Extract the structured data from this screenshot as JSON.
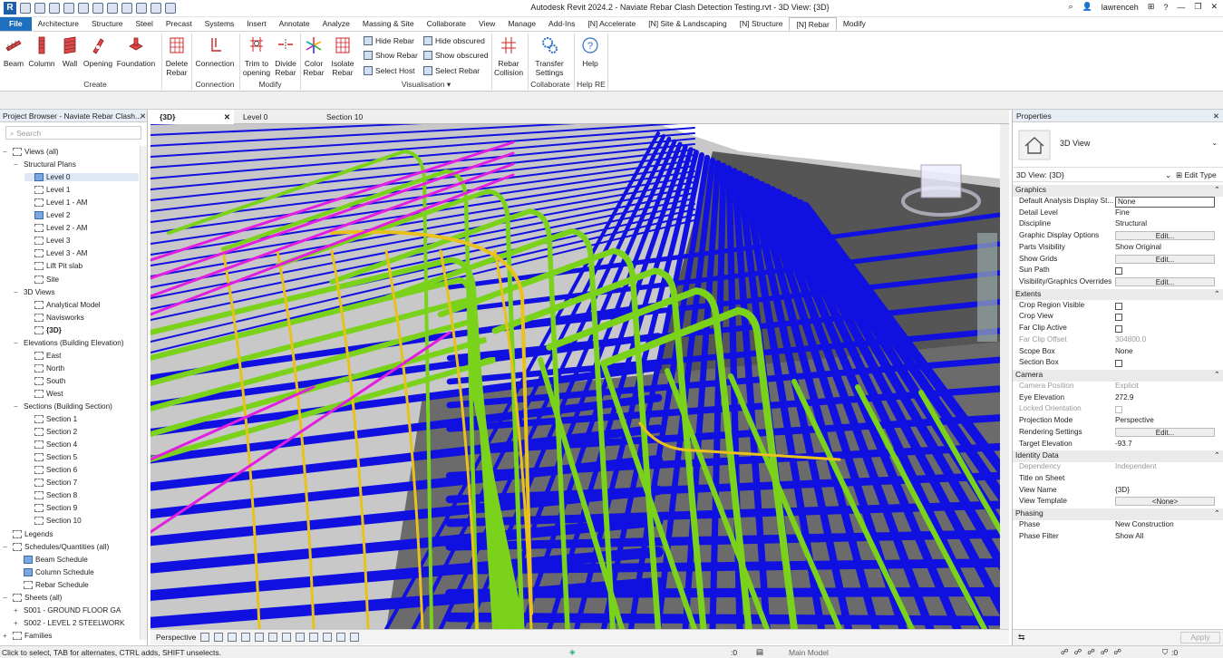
{
  "titlebar": {
    "title": "Autodesk Revit 2024.2 - Naviate Rebar Clash Detection Testing.rvt - 3D View: {3D}",
    "user": "lawrenceh"
  },
  "menu_tabs": [
    "File",
    "Architecture",
    "Structure",
    "Steel",
    "Precast",
    "Systems",
    "Insert",
    "Annotate",
    "Analyze",
    "Massing & Site",
    "Collaborate",
    "View",
    "Manage",
    "Add-Ins",
    "[N] Accelerate",
    "[N] Site & Landscaping",
    "[N] Structure",
    "[N] Rebar",
    "Modify"
  ],
  "ribbon": {
    "create": [
      "Beam",
      "Column",
      "Wall",
      "Opening",
      "Foundation"
    ],
    "delete_rebar": [
      "Delete",
      "Rebar"
    ],
    "connection": "Connection",
    "trim": [
      "Trim to",
      "opening"
    ],
    "divide": [
      "Divide",
      "Rebar"
    ],
    "color": [
      "Color",
      "Rebar"
    ],
    "isolate": [
      "Isolate",
      "Rebar"
    ],
    "visual_small": [
      "Hide Rebar",
      "Show Rebar",
      "Select Host",
      "Hide obscured",
      "Show obscured",
      "Select Rebar"
    ],
    "collision": [
      "Rebar",
      "Collision"
    ],
    "transfer": [
      "Transfer",
      "Settings"
    ],
    "help": "Help",
    "groups": [
      "Create",
      "Connection",
      "Modify",
      "Visualisation",
      "Collaborate",
      "Help RE"
    ]
  },
  "project_browser": {
    "title": "Project Browser - Naviate Rebar Clash...",
    "search_placeholder": "Search",
    "nodes": [
      {
        "label": "Views (all)",
        "level": 0,
        "toggle": "−",
        "icon": "views"
      },
      {
        "label": "Structural Plans",
        "level": 1,
        "toggle": "−",
        "icon": ""
      },
      {
        "label": "Level 0",
        "level": 2,
        "toggle": "",
        "icon": "blue",
        "selected": true
      },
      {
        "label": "Level 1",
        "level": 2,
        "toggle": "",
        "icon": "view"
      },
      {
        "label": "Level 1 - AM",
        "level": 2,
        "toggle": "",
        "icon": "view"
      },
      {
        "label": "Level 2",
        "level": 2,
        "toggle": "",
        "icon": "blue"
      },
      {
        "label": "Level 2 - AM",
        "level": 2,
        "toggle": "",
        "icon": "view"
      },
      {
        "label": "Level 3",
        "level": 2,
        "toggle": "",
        "icon": "view"
      },
      {
        "label": "Level 3 - AM",
        "level": 2,
        "toggle": "",
        "icon": "view"
      },
      {
        "label": "Lift Pit slab",
        "level": 2,
        "toggle": "",
        "icon": "view"
      },
      {
        "label": "Site",
        "level": 2,
        "toggle": "",
        "icon": "view"
      },
      {
        "label": "3D Views",
        "level": 1,
        "toggle": "−",
        "icon": ""
      },
      {
        "label": "Analytical Model",
        "level": 2,
        "toggle": "",
        "icon": "view"
      },
      {
        "label": "Navisworks",
        "level": 2,
        "toggle": "",
        "icon": "view"
      },
      {
        "label": "{3D}",
        "level": 2,
        "toggle": "",
        "icon": "view",
        "bold": true
      },
      {
        "label": "Elevations (Building Elevation)",
        "level": 1,
        "toggle": "−",
        "icon": ""
      },
      {
        "label": "East",
        "level": 2,
        "toggle": "",
        "icon": "view"
      },
      {
        "label": "North",
        "level": 2,
        "toggle": "",
        "icon": "view"
      },
      {
        "label": "South",
        "level": 2,
        "toggle": "",
        "icon": "view"
      },
      {
        "label": "West",
        "level": 2,
        "toggle": "",
        "icon": "view"
      },
      {
        "label": "Sections (Building Section)",
        "level": 1,
        "toggle": "−",
        "icon": ""
      },
      {
        "label": "Section 1",
        "level": 2,
        "toggle": "",
        "icon": "view"
      },
      {
        "label": "Section 2",
        "level": 2,
        "toggle": "",
        "icon": "view"
      },
      {
        "label": "Section 4",
        "level": 2,
        "toggle": "",
        "icon": "view"
      },
      {
        "label": "Section 5",
        "level": 2,
        "toggle": "",
        "icon": "view"
      },
      {
        "label": "Section 6",
        "level": 2,
        "toggle": "",
        "icon": "view"
      },
      {
        "label": "Section 7",
        "level": 2,
        "toggle": "",
        "icon": "view"
      },
      {
        "label": "Section 8",
        "level": 2,
        "toggle": "",
        "icon": "view"
      },
      {
        "label": "Section 9",
        "level": 2,
        "toggle": "",
        "icon": "view"
      },
      {
        "label": "Section 10",
        "level": 2,
        "toggle": "",
        "icon": "view"
      },
      {
        "label": "Legends",
        "level": 0,
        "toggle": "",
        "icon": "view"
      },
      {
        "label": "Schedules/Quantities (all)",
        "level": 0,
        "toggle": "−",
        "icon": "view"
      },
      {
        "label": "Beam Schedule",
        "level": 1,
        "toggle": "",
        "icon": "blue"
      },
      {
        "label": "Column Schedule",
        "level": 1,
        "toggle": "",
        "icon": "blue"
      },
      {
        "label": "Rebar Schedule",
        "level": 1,
        "toggle": "",
        "icon": "view"
      },
      {
        "label": "Sheets (all)",
        "level": 0,
        "toggle": "−",
        "icon": "view"
      },
      {
        "label": "S001 - GROUND FLOOR GA",
        "level": 1,
        "toggle": "+",
        "icon": ""
      },
      {
        "label": "S002 - LEVEL 2 STEELWORK",
        "level": 1,
        "toggle": "+",
        "icon": ""
      },
      {
        "label": "Families",
        "level": 0,
        "toggle": "+",
        "icon": "view"
      }
    ]
  },
  "view_tabs": [
    {
      "label": "{3D}",
      "active": true
    },
    {
      "label": "Level 0",
      "active": false
    },
    {
      "label": "Section 10",
      "active": false
    }
  ],
  "view_bar": {
    "scale": "Perspective"
  },
  "properties": {
    "title": "Properties",
    "type_name": "3D View",
    "instance": "3D View: {3D}",
    "edit_type": "Edit Type",
    "rows": [
      {
        "kind": "header",
        "name": "Graphics"
      },
      {
        "name": "Default Analysis Display St...",
        "value": "None",
        "type": "input"
      },
      {
        "name": "Detail Level",
        "value": "Fine"
      },
      {
        "name": "Discipline",
        "value": "Structural"
      },
      {
        "name": "Graphic Display Options",
        "value": "Edit...",
        "type": "button"
      },
      {
        "name": "Parts Visibility",
        "value": "Show Original"
      },
      {
        "name": "Show Grids",
        "value": "Edit...",
        "type": "button"
      },
      {
        "name": "Sun Path",
        "value": "",
        "type": "check"
      },
      {
        "name": "Visibility/Graphics Overrides",
        "value": "Edit...",
        "type": "button"
      },
      {
        "kind": "header",
        "name": "Extents"
      },
      {
        "name": "Crop Region Visible",
        "value": "",
        "type": "check"
      },
      {
        "name": "Crop View",
        "value": "",
        "type": "check"
      },
      {
        "name": "Far Clip Active",
        "value": "",
        "type": "check"
      },
      {
        "name": "Far Clip Offset",
        "value": "304800.0",
        "dim": true
      },
      {
        "name": "Scope Box",
        "value": "None"
      },
      {
        "name": "Section Box",
        "value": "",
        "type": "check"
      },
      {
        "kind": "header",
        "name": "Camera"
      },
      {
        "name": "Camera Position",
        "value": "Explicit",
        "dim": true
      },
      {
        "name": "Eye Elevation",
        "value": "272.9"
      },
      {
        "name": "Locked Orientation",
        "value": "",
        "type": "check",
        "dim": true
      },
      {
        "name": "Projection Mode",
        "value": "Perspective"
      },
      {
        "name": "Rendering Settings",
        "value": "Edit...",
        "type": "button"
      },
      {
        "name": "Target Elevation",
        "value": "-93.7"
      },
      {
        "kind": "header",
        "name": "Identity Data"
      },
      {
        "name": "Dependency",
        "value": "Independent",
        "dim": true
      },
      {
        "name": "Title on Sheet",
        "value": ""
      },
      {
        "name": "View Name",
        "value": "{3D}"
      },
      {
        "name": "View Template",
        "value": "<None>",
        "type": "button"
      },
      {
        "kind": "header",
        "name": "Phasing"
      },
      {
        "name": "Phase",
        "value": "New Construction"
      },
      {
        "name": "Phase Filter",
        "value": "Show All"
      }
    ],
    "apply": "Apply"
  },
  "status": {
    "hint": "Click to select, TAB for alternates, CTRL adds, SHIFT unselects.",
    "coord": ":0",
    "model": "Main Model",
    "filter": ":0"
  },
  "colors": {
    "file_tab": "#1f6fbf",
    "rebar_blue": "#1010e0",
    "rebar_green": "#7ad21a",
    "rebar_yellow": "#e8c21a",
    "rebar_magenta": "#e21ee2"
  }
}
